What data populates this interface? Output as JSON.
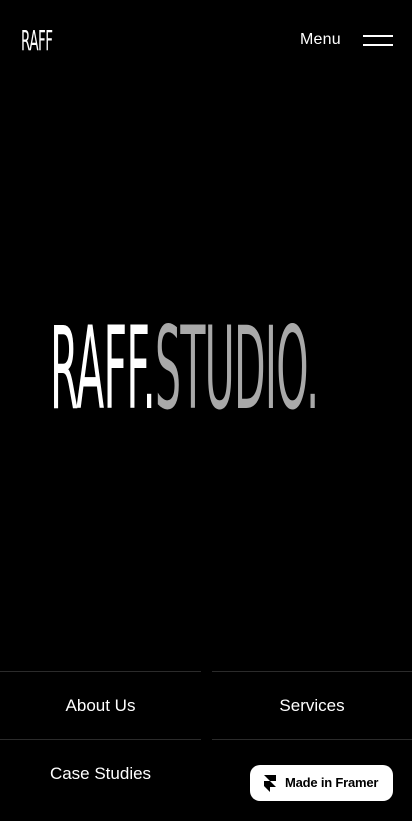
{
  "header": {
    "logo_text": "RAFF",
    "menu_label": "Menu"
  },
  "hero": {
    "title_primary": "RAFF.",
    "title_secondary": "STUDIO."
  },
  "nav": {
    "items": [
      {
        "label": "About Us"
      },
      {
        "label": "Services"
      },
      {
        "label": "Case Studies"
      }
    ]
  },
  "badge": {
    "label": "Made in Framer",
    "icon": "framer-logo-icon"
  },
  "colors": {
    "background": "#000000",
    "text": "#ffffff",
    "hero_secondary": "#a9a9a9",
    "badge_background": "#ffffff",
    "divider": "#2b2b2b"
  }
}
